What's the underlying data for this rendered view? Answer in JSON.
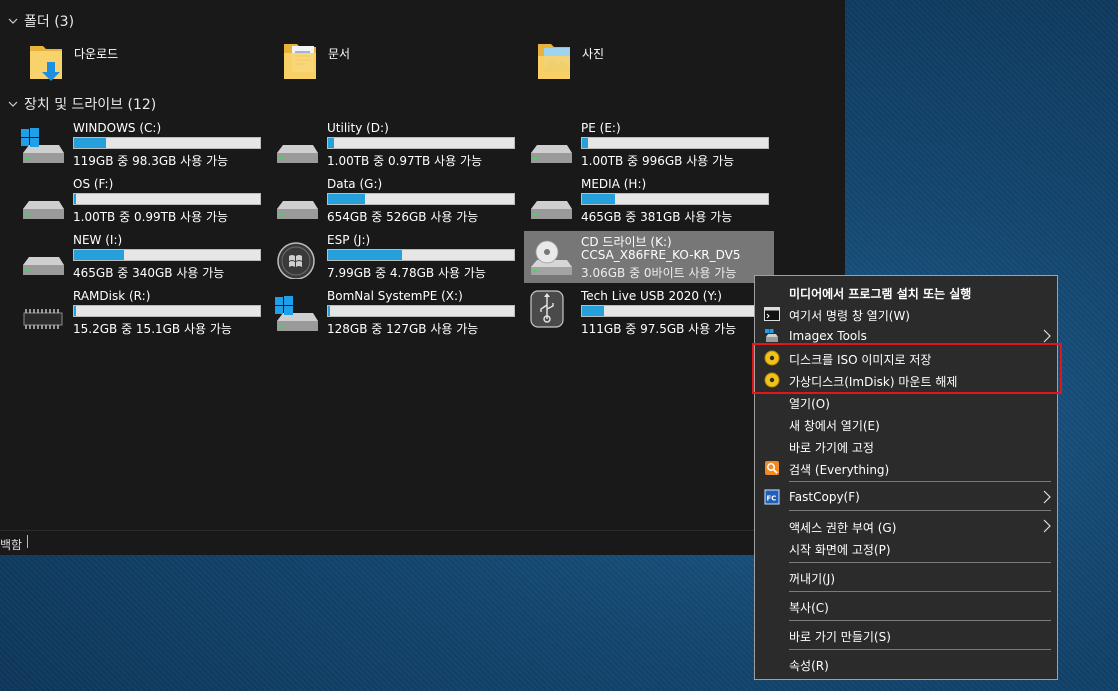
{
  "status": {
    "text": "백함"
  },
  "folders": {
    "header": "폴더 (3)",
    "items": [
      {
        "label": "다운로드",
        "icon": "downloads-folder-icon"
      },
      {
        "label": "문서",
        "icon": "documents-folder-icon"
      },
      {
        "label": "사진",
        "icon": "pictures-folder-icon"
      }
    ]
  },
  "drives": {
    "header": "장치 및 드라이브 (12)",
    "items": [
      {
        "name": "WINDOWS (C:)",
        "info": "119GB 중 98.3GB 사용 가능",
        "used": 0.17,
        "icon": "windows-drive-icon"
      },
      {
        "name": "Utility (D:)",
        "info": "1.00TB 중 0.97TB 사용 가능",
        "used": 0.03,
        "icon": "hard-drive-icon"
      },
      {
        "name": "PE (E:)",
        "info": "1.00TB 중 996GB 사용 가능",
        "used": 0.03,
        "icon": "hard-drive-icon"
      },
      {
        "name": "OS (F:)",
        "info": "1.00TB 중 0.99TB 사용 가능",
        "used": 0.01,
        "icon": "hard-drive-icon"
      },
      {
        "name": "Data (G:)",
        "info": "654GB 중 526GB 사용 가능",
        "used": 0.2,
        "icon": "hard-drive-icon"
      },
      {
        "name": "MEDIA (H:)",
        "info": "465GB 중 381GB 사용 가능",
        "used": 0.18,
        "icon": "hard-drive-icon"
      },
      {
        "name": "NEW (I:)",
        "info": "465GB 중 340GB 사용 가능",
        "used": 0.27,
        "icon": "hard-drive-icon"
      },
      {
        "name": "ESP (J:)",
        "info": "7.99GB 중 4.78GB 사용 가능",
        "used": 0.4,
        "icon": "windows-logo-disk-icon"
      },
      {
        "name": "CD 드라이브 (K:)",
        "name2": "CCSA_X86FRE_KO-KR_DV5",
        "info": "3.06GB 중 0바이트 사용 가능",
        "icon": "cd-drive-icon"
      },
      {
        "name": "RAMDisk (R:)",
        "info": "15.2GB 중 15.1GB 사용 가능",
        "used": 0.01,
        "icon": "ram-chip-icon"
      },
      {
        "name": "BomNal SystemPE (X:)",
        "info": "128GB 중 127GB 사용 가능",
        "used": 0.01,
        "icon": "windows-drive-icon"
      },
      {
        "name": "Tech Live USB 2020 (Y:)",
        "info": "111GB 중 97.5GB 사용 가능",
        "used": 0.12,
        "icon": "usb-drive-icon"
      }
    ]
  },
  "context_menu": {
    "items": [
      {
        "label": "미디어에서 프로그램 설치 또는 실행",
        "bold": true
      },
      {
        "label": "여기서 명령 창 열기(W)",
        "icon": "command-prompt-icon"
      },
      {
        "label": "Imagex Tools",
        "icon": "imagex-icon",
        "submenu": true
      },
      {
        "label": "디스크를 ISO 이미지로 저장",
        "icon": "disc-icon"
      },
      {
        "label": "가상디스크(ImDisk) 마운트 해제",
        "icon": "disc-icon"
      },
      {
        "label": "열기(O)"
      },
      {
        "label": "새 창에서 열기(E)"
      },
      {
        "label": "바로 가기에 고정"
      },
      {
        "label": "검색 (Everything)",
        "icon": "everything-search-icon"
      },
      {
        "label": "FastCopy(F)",
        "icon": "fastcopy-icon",
        "submenu": true
      },
      {
        "label": "액세스 권한 부여 (G)",
        "submenu": true
      },
      {
        "label": "시작 화면에 고정(P)"
      },
      {
        "label": "꺼내기(J)"
      },
      {
        "label": "복사(C)"
      },
      {
        "label": "바로 가기 만들기(S)"
      },
      {
        "label": "속성(R)"
      }
    ]
  },
  "colors": {
    "usage_bar": "#26a0da",
    "highlight_box": "#e0161b"
  }
}
